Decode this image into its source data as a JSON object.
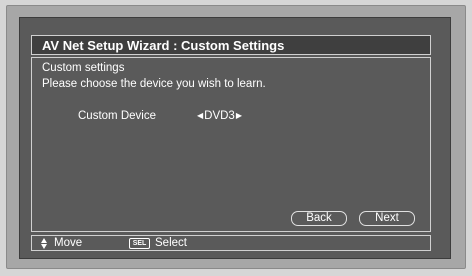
{
  "window": {
    "title": "AV Net Setup Wizard : Custom Settings"
  },
  "content": {
    "heading": "Custom settings",
    "instruction": "Please choose the device you wish to learn.",
    "device_label": "Custom Device",
    "device_value": "DVD3",
    "left_arrow": "◀",
    "right_arrow": "▶"
  },
  "buttons": {
    "back": "Back",
    "next": "Next"
  },
  "status_bar": {
    "move_label": "Move",
    "sel_icon": "SEL",
    "select_label": "Select"
  },
  "icons": {
    "nav": "up-down-arrows-icon",
    "sel": "sel-key-icon"
  },
  "colors": {
    "screen_bg": "#5a5a5a",
    "title_bg": "#3f3f3f",
    "border": "#d0d0d0",
    "text": "#ffffff"
  }
}
